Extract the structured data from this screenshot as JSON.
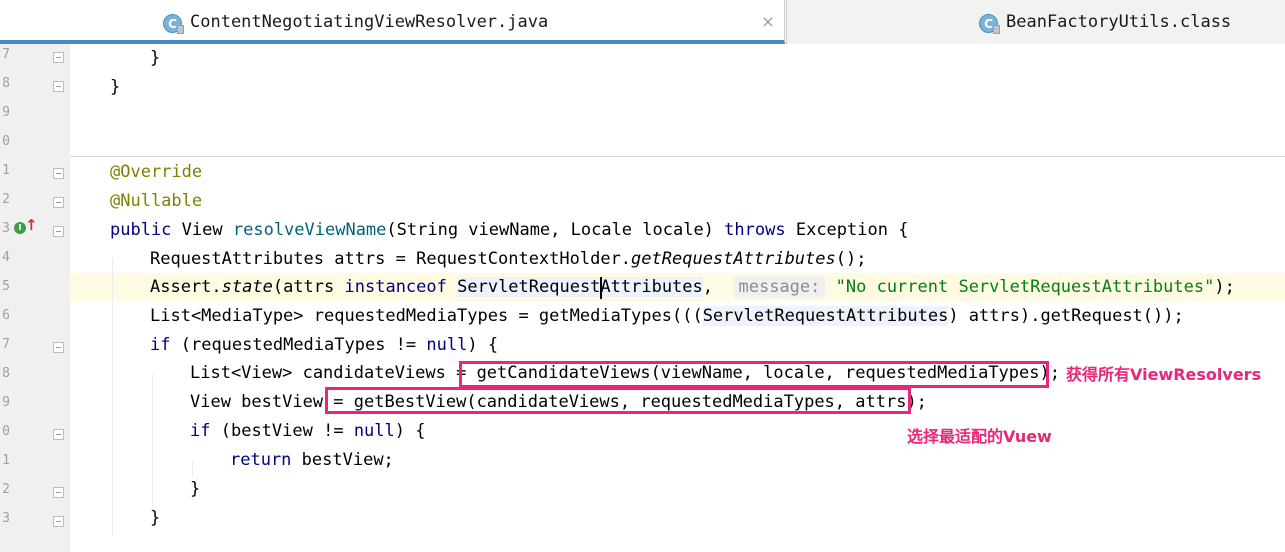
{
  "tabs": [
    {
      "label": "ContentNegotiatingViewResolver.java",
      "icon": "class-icon",
      "active": true,
      "close_symbol": "×"
    },
    {
      "label": "BeanFactoryUtils.class",
      "icon": "class-icon",
      "active": false
    }
  ],
  "tab_icon_letter": "C",
  "gutter": {
    "line_numbers": [
      "7",
      "8",
      "9",
      "0",
      "1",
      "2",
      "3",
      "4",
      "5",
      "6",
      "7",
      "8",
      "9",
      "0",
      "1",
      "2",
      "3"
    ],
    "impl_icon_letter": "I",
    "override_arrow": "↑"
  },
  "code": {
    "l1": "}",
    "l2": "}",
    "l5": "@Override",
    "l6": "@Nullable",
    "l7": {
      "kw_public": "public",
      "type": "View",
      "method": "resolveViewName",
      "params": "(String viewName, Locale locale)",
      "kw_throws": "throws",
      "tail": "Exception {"
    },
    "l8": {
      "head": "RequestAttributes attrs = RequestContextHolder.",
      "call": "getRequestAttributes",
      "tail": "();"
    },
    "l9": {
      "head": "Assert.",
      "call": "state",
      "mid": "(attrs",
      "kw_instanceof": "instanceof",
      "type": "ServletRequestAttributes",
      "comma": ",",
      "hint": "message:",
      "str": "\"No current ServletRequestAttributes\"",
      "tail": ");"
    },
    "l10": {
      "head": "List<MediaType> requestedMediaTypes = getMediaTypes(((",
      "type": "ServletRequestAttributes",
      "tail": ") attrs).getRequest());"
    },
    "l11": {
      "kw_if": "if",
      "mid": "(requestedMediaTypes !=",
      "kw_null": "null",
      "tail": ") {"
    },
    "l12": "List<View> candidateViews = getCandidateViews(viewName, locale, requestedMediaTypes);",
    "l13": "View bestView = getBestView(candidateViews, requestedMediaTypes, attrs);",
    "l14": {
      "kw_if": "if",
      "mid": "(bestView !=",
      "kw_null": "null",
      "tail": ") {"
    },
    "l15": {
      "kw_return": "return",
      "tail": "bestView;"
    },
    "l16": "}",
    "l17": "}"
  },
  "annotations": {
    "note1": "获得所有ViewResolvers",
    "note2": "选择最适配的Vuew",
    "color": "#e8267a"
  },
  "colors": {
    "keyword": "#000080",
    "annotation": "#808000",
    "method_decl": "#00627a",
    "string": "#067d17",
    "tab_underline": "#4a88c7"
  }
}
